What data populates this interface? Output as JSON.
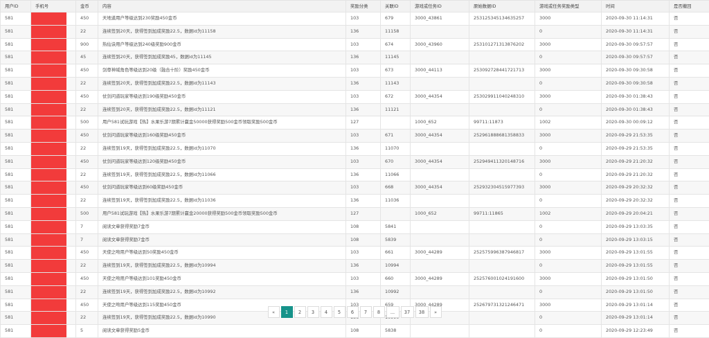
{
  "table": {
    "headers": [
      "用户ID",
      "手机号",
      "金币",
      "内容",
      "奖励分类",
      "关联ID",
      "游戏或任务ID",
      "原始数据ID",
      "游戏或任务奖励类型",
      "时间",
      "是否撤回"
    ],
    "rows": [
      [
        "581",
        "",
        "450",
        "天地道用户等级达到230奖励450金币",
        "103",
        "679",
        "3000_43861",
        "253125345134635257",
        "3000",
        "2020-09-30 11:14:31",
        "否"
      ],
      [
        "581",
        "",
        "22",
        "连续签到20天，获得签到加成奖励22.5，数据id为11158",
        "136",
        "11158",
        "",
        "",
        "0",
        "2020-09-30 11:14:31",
        "否"
      ],
      [
        "581",
        "",
        "900",
        "热仙诀用户等级达到240级奖励900金币",
        "103",
        "674",
        "3000_43960",
        "253101271313876202",
        "3000",
        "2020-09-30 09:57:57",
        "否"
      ],
      [
        "581",
        "",
        "45",
        "连续签到20天，获得签到加成奖励45，数据id为11145",
        "136",
        "11145",
        "",
        "",
        "0",
        "2020-09-30 09:57:57",
        "否"
      ],
      [
        "581",
        "",
        "450",
        "剑尊神域角色等级达到20级（融合十阶）奖励450金币",
        "103",
        "673",
        "3000_44113",
        "253092728441721713",
        "3000",
        "2020-09-30 09:30:58",
        "否"
      ],
      [
        "581",
        "",
        "22",
        "连续签到20天，获得签到加成奖励22.5，数据id为11143",
        "136",
        "11143",
        "",
        "",
        "0",
        "2020-09-30 09:30:58",
        "否"
      ],
      [
        "581",
        "",
        "450",
        "仗剑问道玩家等级达到190级奖励450金币",
        "103",
        "672",
        "3000_44354",
        "253029911040248310",
        "3000",
        "2020-09-30 01:38:43",
        "否"
      ],
      [
        "581",
        "",
        "22",
        "连续签到20天，获得签到加成奖励22.5，数据id为11121",
        "136",
        "11121",
        "",
        "",
        "0",
        "2020-09-30 01:38:43",
        "否"
      ],
      [
        "581",
        "",
        "500",
        "用户581试玩游戏【热】水果乐游7期累计赢金50000获得奖励500金币领取奖励500金币",
        "127",
        "",
        "1000_652",
        "99711:11873",
        "1002",
        "2020-09-30 00:09:12",
        "否"
      ],
      [
        "581",
        "",
        "450",
        "仗剑问道玩家等级达到160级奖励450金币",
        "103",
        "671",
        "3000_44354",
        "252961888681358833",
        "3000",
        "2020-09-29 21:53:35",
        "否"
      ],
      [
        "581",
        "",
        "22",
        "连续签到19天，获得签到加成奖励22.5，数据id为11070",
        "136",
        "11070",
        "",
        "",
        "0",
        "2020-09-29 21:53:35",
        "否"
      ],
      [
        "581",
        "",
        "450",
        "仗剑问道玩家等级达到120级奖励450金币",
        "103",
        "670",
        "3000_44354",
        "252949411320148716",
        "3000",
        "2020-09-29 21:20:32",
        "否"
      ],
      [
        "581",
        "",
        "22",
        "连续签到19天，获得签到加成奖励22.5，数据id为11066",
        "136",
        "11066",
        "",
        "",
        "0",
        "2020-09-29 21:20:32",
        "否"
      ],
      [
        "581",
        "",
        "450",
        "仗剑问道玩家等级达到60级奖励450金币",
        "103",
        "668",
        "3000_44354",
        "252932304515977393",
        "3000",
        "2020-09-29 20:32:32",
        "否"
      ],
      [
        "581",
        "",
        "22",
        "连续签到19天，获得签到加成奖励22.5，数据id为11036",
        "136",
        "11036",
        "",
        "",
        "0",
        "2020-09-29 20:32:32",
        "否"
      ],
      [
        "581",
        "",
        "500",
        "用户581试玩游戏【热】水果乐游7期累计赢金20000获得奖励500金币领取奖励500金币",
        "127",
        "",
        "1000_652",
        "99711:11865",
        "1002",
        "2020-09-29 20:04:21",
        "否"
      ],
      [
        "581",
        "",
        "7",
        "阅读文章获得奖励7金币",
        "108",
        "5841",
        "",
        "",
        "0",
        "2020-09-29 13:03:35",
        "否"
      ],
      [
        "581",
        "",
        "7",
        "阅读文章获得奖励7金币",
        "108",
        "5839",
        "",
        "",
        "0",
        "2020-09-29 13:03:15",
        "否"
      ],
      [
        "581",
        "",
        "450",
        "天使之吻用户等级达到50奖励450金币",
        "103",
        "661",
        "3000_44289",
        "252575996387946817",
        "3000",
        "2020-09-29 13:01:55",
        "否"
      ],
      [
        "581",
        "",
        "22",
        "连续签到19天，获得签到加成奖励22.5，数据id为10994",
        "136",
        "10994",
        "",
        "",
        "0",
        "2020-09-29 13:01:55",
        "否"
      ],
      [
        "581",
        "",
        "450",
        "天使之吻用户等级达到101奖励450金币",
        "103",
        "660",
        "3000_44289",
        "252576001024191600",
        "3000",
        "2020-09-29 13:01:50",
        "否"
      ],
      [
        "581",
        "",
        "22",
        "连续签到19天，获得签到加成奖励22.5，数据id为10992",
        "136",
        "10992",
        "",
        "",
        "0",
        "2020-09-29 13:01:50",
        "否"
      ],
      [
        "581",
        "",
        "450",
        "天使之吻用户等级达到115奖励450金币",
        "103",
        "659",
        "3000_44289",
        "252679731321246471",
        "3000",
        "2020-09-29 13:01:14",
        "否"
      ],
      [
        "581",
        "",
        "22",
        "连续签到19天，获得签到加成奖励22.5，数据id为10990",
        "136",
        "10990",
        "",
        "",
        "0",
        "2020-09-29 13:01:14",
        "否"
      ],
      [
        "581",
        "",
        "5",
        "阅读文章获得奖励5金币",
        "108",
        "5838",
        "",
        "",
        "0",
        "2020-09-29 12:23:49",
        "否"
      ]
    ]
  },
  "pagination": {
    "prev": "«",
    "pages": [
      "1",
      "2",
      "3",
      "4",
      "5",
      "6",
      "7",
      "8",
      "...",
      "37",
      "38"
    ],
    "next": "»",
    "current": "1",
    "active_color": "#16938a"
  },
  "redaction_color": "#f23b3b"
}
